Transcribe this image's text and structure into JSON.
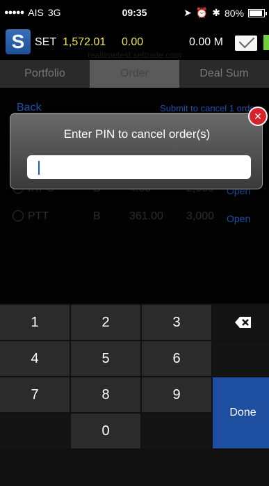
{
  "status_bar": {
    "carrier_dots": "●●●●●",
    "carrier": "AIS",
    "network": "3G",
    "time": "09:35",
    "battery": "80%"
  },
  "header": {
    "logo": "S",
    "market": "SET",
    "index": "1,572.01",
    "change": "0.00",
    "volume": "0.00 M",
    "subdomain": "realtimetest.settrade.com"
  },
  "tabs": [
    "Portfolio",
    "Order",
    "Deal Sum"
  ],
  "order": {
    "back_label": "Back",
    "submit_label": "Submit to cancel 1 order",
    "rows": [
      {
        "symbol": "IRPC",
        "side": "B",
        "price": "4.68",
        "qty": "2,000",
        "status": "Open"
      },
      {
        "symbol": "PTT",
        "side": "B",
        "price": "361.00",
        "qty": "3,000",
        "status": "Open"
      }
    ]
  },
  "dialog": {
    "title": "Enter PIN to cancel order(s)",
    "input_value": ""
  },
  "keypad": {
    "keys": [
      "1",
      "2",
      "3",
      "4",
      "5",
      "6",
      "7",
      "8",
      "9",
      "0"
    ],
    "done_label": "Done"
  },
  "colors": {
    "accent_blue": "#1d4ea0",
    "index_yellow": "#f2e84a",
    "close_red": "#d6222a"
  }
}
